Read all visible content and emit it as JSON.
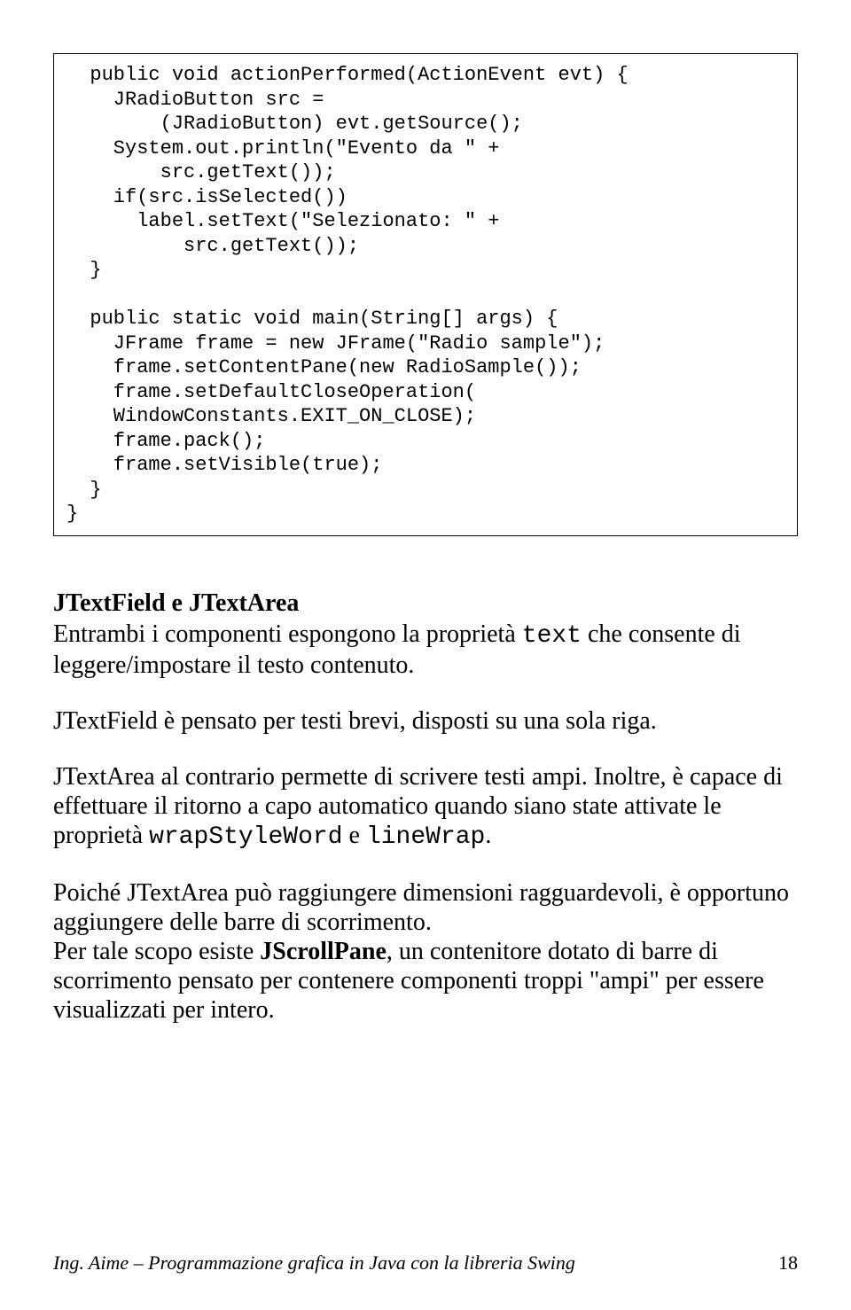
{
  "code": {
    "l1": "  public void actionPerformed(ActionEvent evt) {",
    "l2": "    JRadioButton src =",
    "l3": "        (JRadioButton) evt.getSource();",
    "l4": "    System.out.println(\"Evento da \" +",
    "l5": "        src.getText());",
    "l6": "    if(src.isSelected())",
    "l7": "      label.setText(\"Selezionato: \" +",
    "l8": "          src.getText());",
    "l9": "  }",
    "l10": "",
    "l11": "  public static void main(String[] args) {",
    "l12": "    JFrame frame = new JFrame(\"Radio sample\");",
    "l13": "    frame.setContentPane(new RadioSample());",
    "l14": "    frame.setDefaultCloseOperation(",
    "l15": "    WindowConstants.EXIT_ON_CLOSE);",
    "l16": "    frame.pack();",
    "l17": "    frame.setVisible(true);",
    "l18": "  }",
    "l19": "}"
  },
  "heading": "JTextField e JTextArea",
  "p1a": "Entrambi i componenti espongono la proprietà ",
  "p1b": "text",
  "p1c": "  che consente di leggere/impostare il testo contenuto.",
  "p2": "JTextField è pensato per testi brevi, disposti su una sola riga.",
  "p3a": "JTextArea al contrario permette di scrivere testi ampi. Inoltre, è capace di effettuare il ritorno a capo automatico quando siano state attivate le proprietà ",
  "p3b": "wrapStyleWord",
  "p3c": " e ",
  "p3d": "lineWrap",
  "p3e": ".",
  "p4a": "Poiché JTextArea può raggiungere dimensioni ragguardevoli, è opportuno aggiungere delle barre di scorrimento.",
  "p4b1": "Per tale scopo esiste ",
  "p4b2": "JScrollPane",
  "p4b3": ", un contenitore dotato di barre di scorrimento pensato per contenere componenti troppi \"ampi\" per essere visualizzati per intero.",
  "footer_left": "Ing. Aime – Programmazione grafica in Java con la libreria Swing",
  "footer_page": "18"
}
